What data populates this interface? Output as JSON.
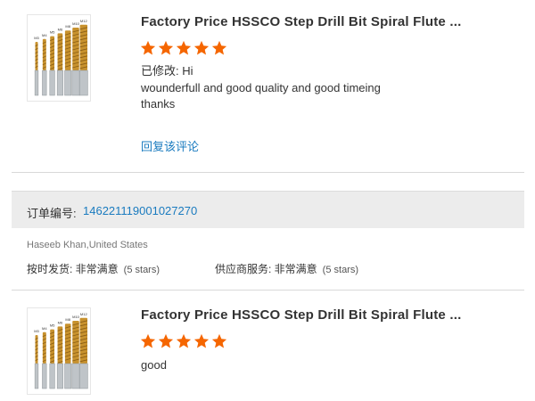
{
  "reviews": [
    {
      "product_title": "Factory Price HSSCO Step Drill Bit Spiral Flute ...",
      "rating": 5,
      "star_color": "#f56600",
      "modified_label": "已修改:",
      "modified_text": "Hi",
      "text_lines": [
        "wounderfull and good quality and good timeing",
        "thanks"
      ],
      "reply_label": "回复该评论",
      "image_bit_labels": [
        "M3",
        "M4",
        "M5",
        "M6",
        "M8",
        "M10",
        "M12"
      ]
    },
    {
      "product_title": "Factory Price HSSCO Step Drill Bit Spiral Flute ...",
      "rating": 5,
      "star_color": "#f56600",
      "text": "good",
      "image_bit_labels": [
        "M3",
        "M4",
        "M5",
        "M6",
        "M8",
        "M10",
        "M12"
      ]
    }
  ],
  "order": {
    "label": "订单编号:",
    "number": "146221119001027270"
  },
  "buyer": "Haseeb Khan,United States",
  "seller_ratings": {
    "shipping_label": "按时发货: 非常满意",
    "shipping_stars": "(5 stars)",
    "service_label": "供应商服务: 非常满意",
    "service_stars": "(5 stars)"
  },
  "colors": {
    "link": "#1a7bbf",
    "star": "#f56600",
    "order_bar_bg": "#ececec",
    "divider": "#d9d9d9"
  },
  "icons": [
    "star-icon",
    "drill-bit-set-image"
  ]
}
